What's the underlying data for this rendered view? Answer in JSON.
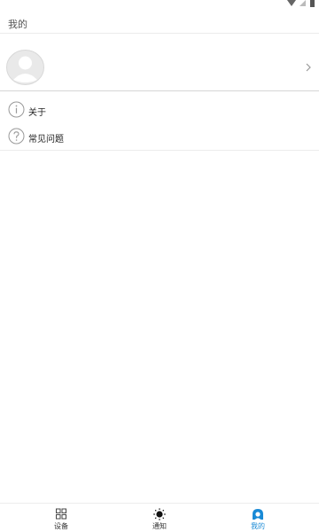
{
  "header": {
    "title": "我的"
  },
  "status_bar": {
    "icons": [
      "wifi-icon",
      "signal-icon",
      "battery-icon"
    ]
  },
  "profile": {
    "avatar_icon": "avatar-placeholder-icon",
    "chevron_icon": "chevron-right-icon"
  },
  "menu": {
    "items": [
      {
        "label": "关于",
        "icon": "info-circle-icon"
      },
      {
        "label": "常见问题",
        "icon": "question-circle-icon"
      }
    ]
  },
  "bottom_nav": {
    "items": [
      {
        "label": "设备",
        "icon": "grid-icon",
        "active": false
      },
      {
        "label": "通知",
        "icon": "sun-icon",
        "active": false
      },
      {
        "label": "我的",
        "icon": "user-icon",
        "active": true
      }
    ],
    "active_color": "#1a8ad6"
  }
}
